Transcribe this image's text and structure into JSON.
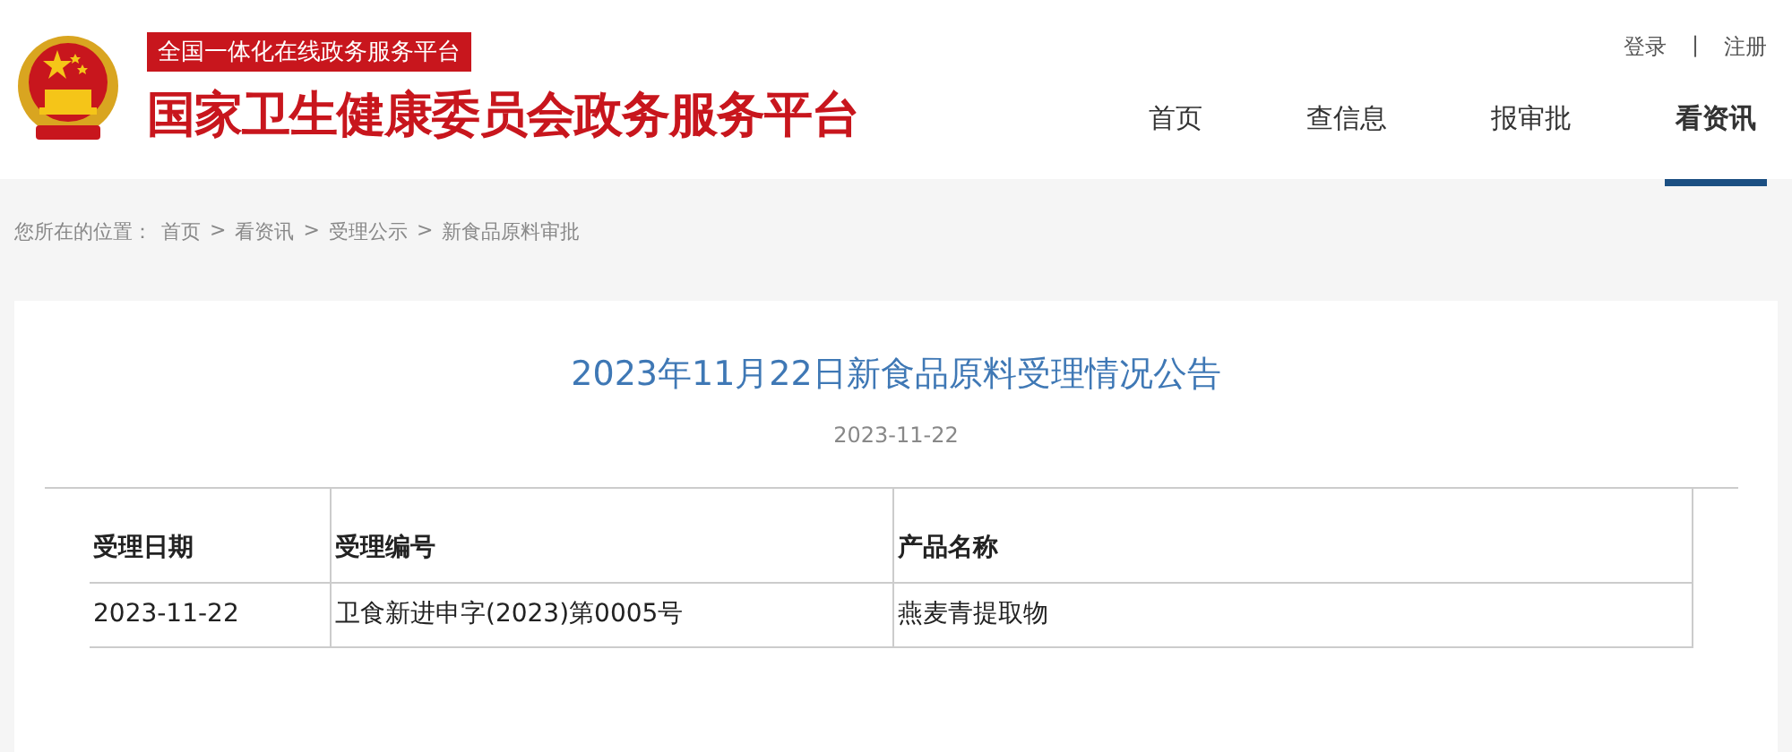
{
  "header": {
    "badge": "全国一体化在线政务服务平台",
    "site_title": "国家卫生健康委员会政务服务平台",
    "account_links": [
      {
        "label": "登录"
      },
      {
        "label": "注册"
      }
    ],
    "account_separator": "|",
    "nav": [
      {
        "label": "首页",
        "selected": false
      },
      {
        "label": "查信息",
        "selected": false
      },
      {
        "label": "报审批",
        "selected": false
      },
      {
        "label": "看资讯",
        "selected": true
      }
    ]
  },
  "breadcrumb": {
    "label": "您所在的位置：",
    "separator": ">",
    "items": [
      "首页",
      "看资讯",
      "受理公示",
      "新食品原料审批"
    ]
  },
  "article": {
    "title": "2023年11月22日新食品原料受理情况公告",
    "date": "2023-11-22",
    "table": {
      "columns": [
        "受理日期",
        "受理编号",
        "产品名称"
      ],
      "rows": [
        [
          "2023-11-22",
          "卫食新进申字(2023)第0005号",
          "燕麦青提取物"
        ]
      ]
    }
  }
}
